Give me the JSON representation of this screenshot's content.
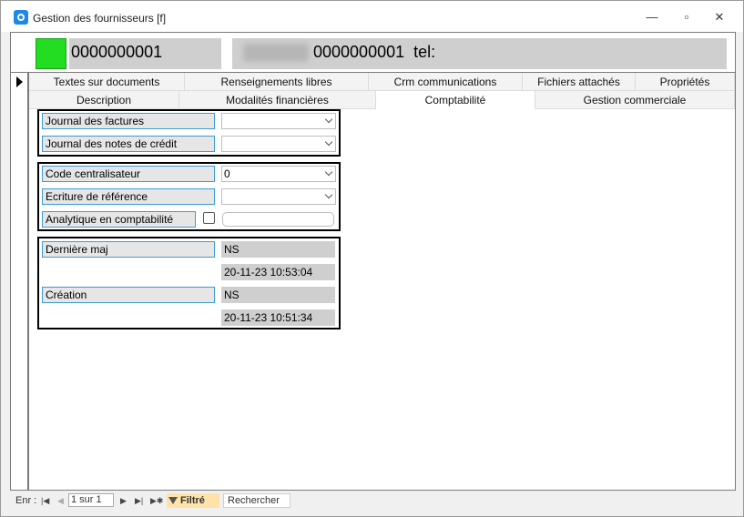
{
  "window": {
    "title": "Gestion des fournisseurs [f]",
    "minimize_glyph": "—",
    "restore_glyph": "▫",
    "close_glyph": "✕"
  },
  "header": {
    "code": "0000000001",
    "info_text": "0000000001  tel:"
  },
  "tabs": {
    "row1": [
      "Textes sur documents",
      "Renseignements libres",
      "Crm communications",
      "Fichiers attachés",
      "Propriétés"
    ],
    "row2": [
      "Description",
      "Modalités financières",
      "Comptabilité",
      "Gestion commerciale"
    ],
    "active": "Comptabilité"
  },
  "journals": {
    "factures_label": "Journal des factures",
    "factures_value": "",
    "notes_credit_label": "Journal des notes de crédit",
    "notes_credit_value": ""
  },
  "accounting": {
    "code_centralisateur_label": "Code centralisateur",
    "code_centralisateur_value": "0",
    "ecriture_label": "Ecriture de référence",
    "ecriture_value": "",
    "analytique_label": "Analytique en comptabilité",
    "analytique_checked": false
  },
  "audit": {
    "derniere_maj_label": "Dernière maj",
    "derniere_maj_user": "NS",
    "derniere_maj_date": "20-11-23 10:53:04",
    "creation_label": "Création",
    "creation_user": "NS",
    "creation_date": "20-11-23 10:51:34"
  },
  "navbar": {
    "record_label": "Enr :",
    "first_glyph": "|◀",
    "prev_glyph": "◀",
    "record_value": "1 sur 1",
    "next_glyph": "▶",
    "last_glyph": "▶|",
    "new_glyph": "▶✱",
    "filter_label": "Filtré",
    "search_label": "Rechercher"
  }
}
